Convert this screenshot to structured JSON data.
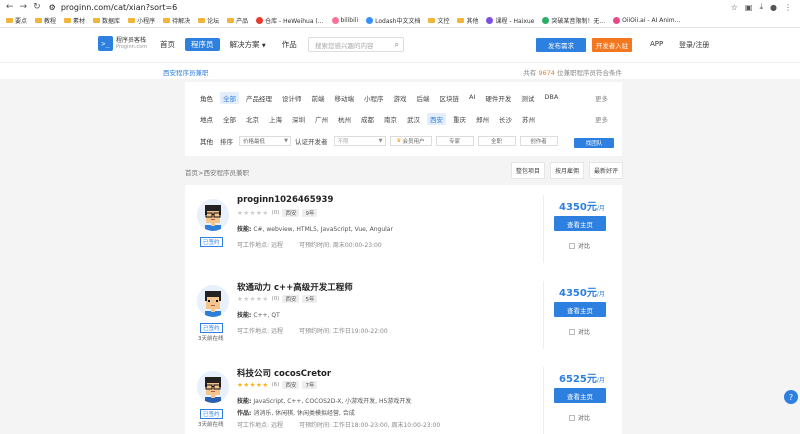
{
  "browser": {
    "url": "proginn.com/cat/xian?sort=6",
    "bookmarks": [
      {
        "label": "要点",
        "type": "folder"
      },
      {
        "label": "教程",
        "type": "folder"
      },
      {
        "label": "素材",
        "type": "folder"
      },
      {
        "label": "数据库",
        "type": "folder"
      },
      {
        "label": "小程序",
        "type": "folder"
      },
      {
        "label": "待解决",
        "type": "folder"
      },
      {
        "label": "论坛",
        "type": "folder"
      },
      {
        "label": "产品",
        "type": "folder"
      },
      {
        "label": "仓库 - HeWeihua (...",
        "type": "site",
        "color": "#e63b2e"
      },
      {
        "label": "bilibili",
        "type": "site",
        "color": "#fb7299"
      },
      {
        "label": "Lodash中文文档",
        "type": "site",
        "color": "#3492ff"
      },
      {
        "label": "文控",
        "type": "folder"
      },
      {
        "label": "其他",
        "type": "folder"
      },
      {
        "label": "课程 - Haixue",
        "type": "site",
        "color": "#7d4fe0"
      },
      {
        "label": "突破某音限制！无...",
        "type": "site",
        "color": "#2aae67"
      },
      {
        "label": "OiiOii.ai - AI Anim...",
        "type": "site",
        "color": "#e9488b"
      }
    ]
  },
  "site": {
    "logo_line1": "程序员客栈",
    "logo_line2": "Proginn.com",
    "nav": [
      "首页",
      "程序员",
      "解决方案",
      "作品"
    ],
    "search_placeholder": "搜索您感兴趣的内容",
    "publish_btn": "发布需求",
    "join_btn": "开发者入驻",
    "app_link": "APP",
    "login_link": "登录/注册"
  },
  "subheader": {
    "left": "西安程序员兼职",
    "right_prefix": "共有",
    "right_count": "9674",
    "right_suffix": "位兼职程序员符合条件"
  },
  "filters": {
    "role_label": "角色",
    "roles": [
      "全部",
      "产品经理",
      "设计师",
      "前端",
      "移动端",
      "小程序",
      "游戏",
      "后端",
      "区块链",
      "AI",
      "硬件开发",
      "测试",
      "DBA"
    ],
    "role_active": "全部",
    "place_label": "地点",
    "places": [
      "全部",
      "北京",
      "上海",
      "深圳",
      "广州",
      "杭州",
      "成都",
      "南京",
      "武汉",
      "西安",
      "重庆",
      "郑州",
      "长沙",
      "苏州"
    ],
    "place_active": "西安",
    "more": "更多",
    "other_label": "其他",
    "sort_label": "排序",
    "sort_value": "价格最低",
    "auth_label": "认证开发者",
    "auth_value": "不限",
    "member_label": "会员用户",
    "expert_label": "专家",
    "fulltime_label": "全职",
    "creator_label": "创作者",
    "find_btn": "找团队"
  },
  "breadcrumb": "首页>西安程序员兼职",
  "sort_tabs": [
    "整包项目",
    "按月雇佣",
    "最新好评"
  ],
  "cards": [
    {
      "name": "proginn1026465939",
      "rating": "0",
      "stars_filled": 0,
      "city": "西安",
      "years": "9年",
      "skills_label": "技能:",
      "skills": "C#, webview, HTML5, JavaScript, Vue, Angular",
      "works_label": "",
      "works": "",
      "location_label": "可工作地点:",
      "location": "远程",
      "time_label": "可预约时间:",
      "time": "周末00:00-23:00",
      "verified": "已签约",
      "online": "",
      "price": "4350元",
      "price_unit": "/月",
      "view_btn": "查看主页",
      "compare": "对比"
    },
    {
      "name": "软通动力 c++高级开发工程师",
      "rating": "0",
      "stars_filled": 0,
      "city": "西安",
      "years": "5年",
      "skills_label": "技能:",
      "skills": "C++, QT",
      "works_label": "",
      "works": "",
      "location_label": "可工作地点:",
      "location": "远程",
      "time_label": "可预约时间:",
      "time": "工作日19:00-22:00",
      "verified": "已签约",
      "online": "3天前在线",
      "price": "4350元",
      "price_unit": "/月",
      "view_btn": "查看主页",
      "compare": "对比"
    },
    {
      "name": "科技公司 cocosCretor",
      "rating": "6",
      "stars_filled": 5,
      "city": "西安",
      "years": "7年",
      "skills_label": "技能:",
      "skills": "JavaScript, C++, COCOS2D-X, 小游戏开发, H5游戏开发",
      "works_label": "作品:",
      "works": "消消乐, 休闲棋, 休闲类模拟经营, 合成",
      "location_label": "可工作地点:",
      "location": "远程",
      "time_label": "可预约时间:",
      "time": "工作日18:00-23:00, 周末10:00-23:00",
      "verified": "已签约",
      "online": "3天前在线",
      "price": "6525元",
      "price_unit": "/月",
      "view_btn": "查看主页",
      "compare": "对比"
    }
  ],
  "colors": {
    "primary": "#2d7fe0",
    "orange": "#f2771f",
    "star": "#f5b516"
  }
}
